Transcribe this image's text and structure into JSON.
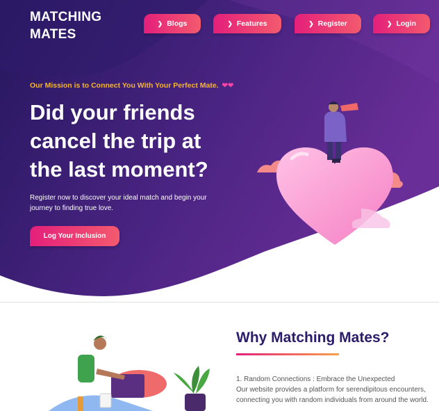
{
  "brand": {
    "line1": "MATCHING",
    "line2": "MATES"
  },
  "nav": [
    {
      "label": "Blogs"
    },
    {
      "label": "Features"
    },
    {
      "label": "Register"
    },
    {
      "label": "Login"
    }
  ],
  "hero": {
    "mission": "Our Mission is to Connect You With Your Perfect Mate.",
    "headline": "Did your friends cancel the trip at the last moment?",
    "subtext": "Register now to discover your ideal match and begin your journey to finding true love.",
    "cta_label": "Log Your Inclusion"
  },
  "why": {
    "title": "Why Matching Mates?",
    "item1_title": "1. Random Connections : Embrace the Unexpected",
    "item1_text": "Our website provides a platform for serendipitous encounters, connecting you with random individuals from around the world."
  },
  "colors": {
    "hero_dark": "#2a1a64",
    "hero_purple": "#5b2a8c",
    "accent_pink": "#e41f7b",
    "accent_orange": "#f7b42c",
    "title_navy": "#2b1b6b"
  }
}
